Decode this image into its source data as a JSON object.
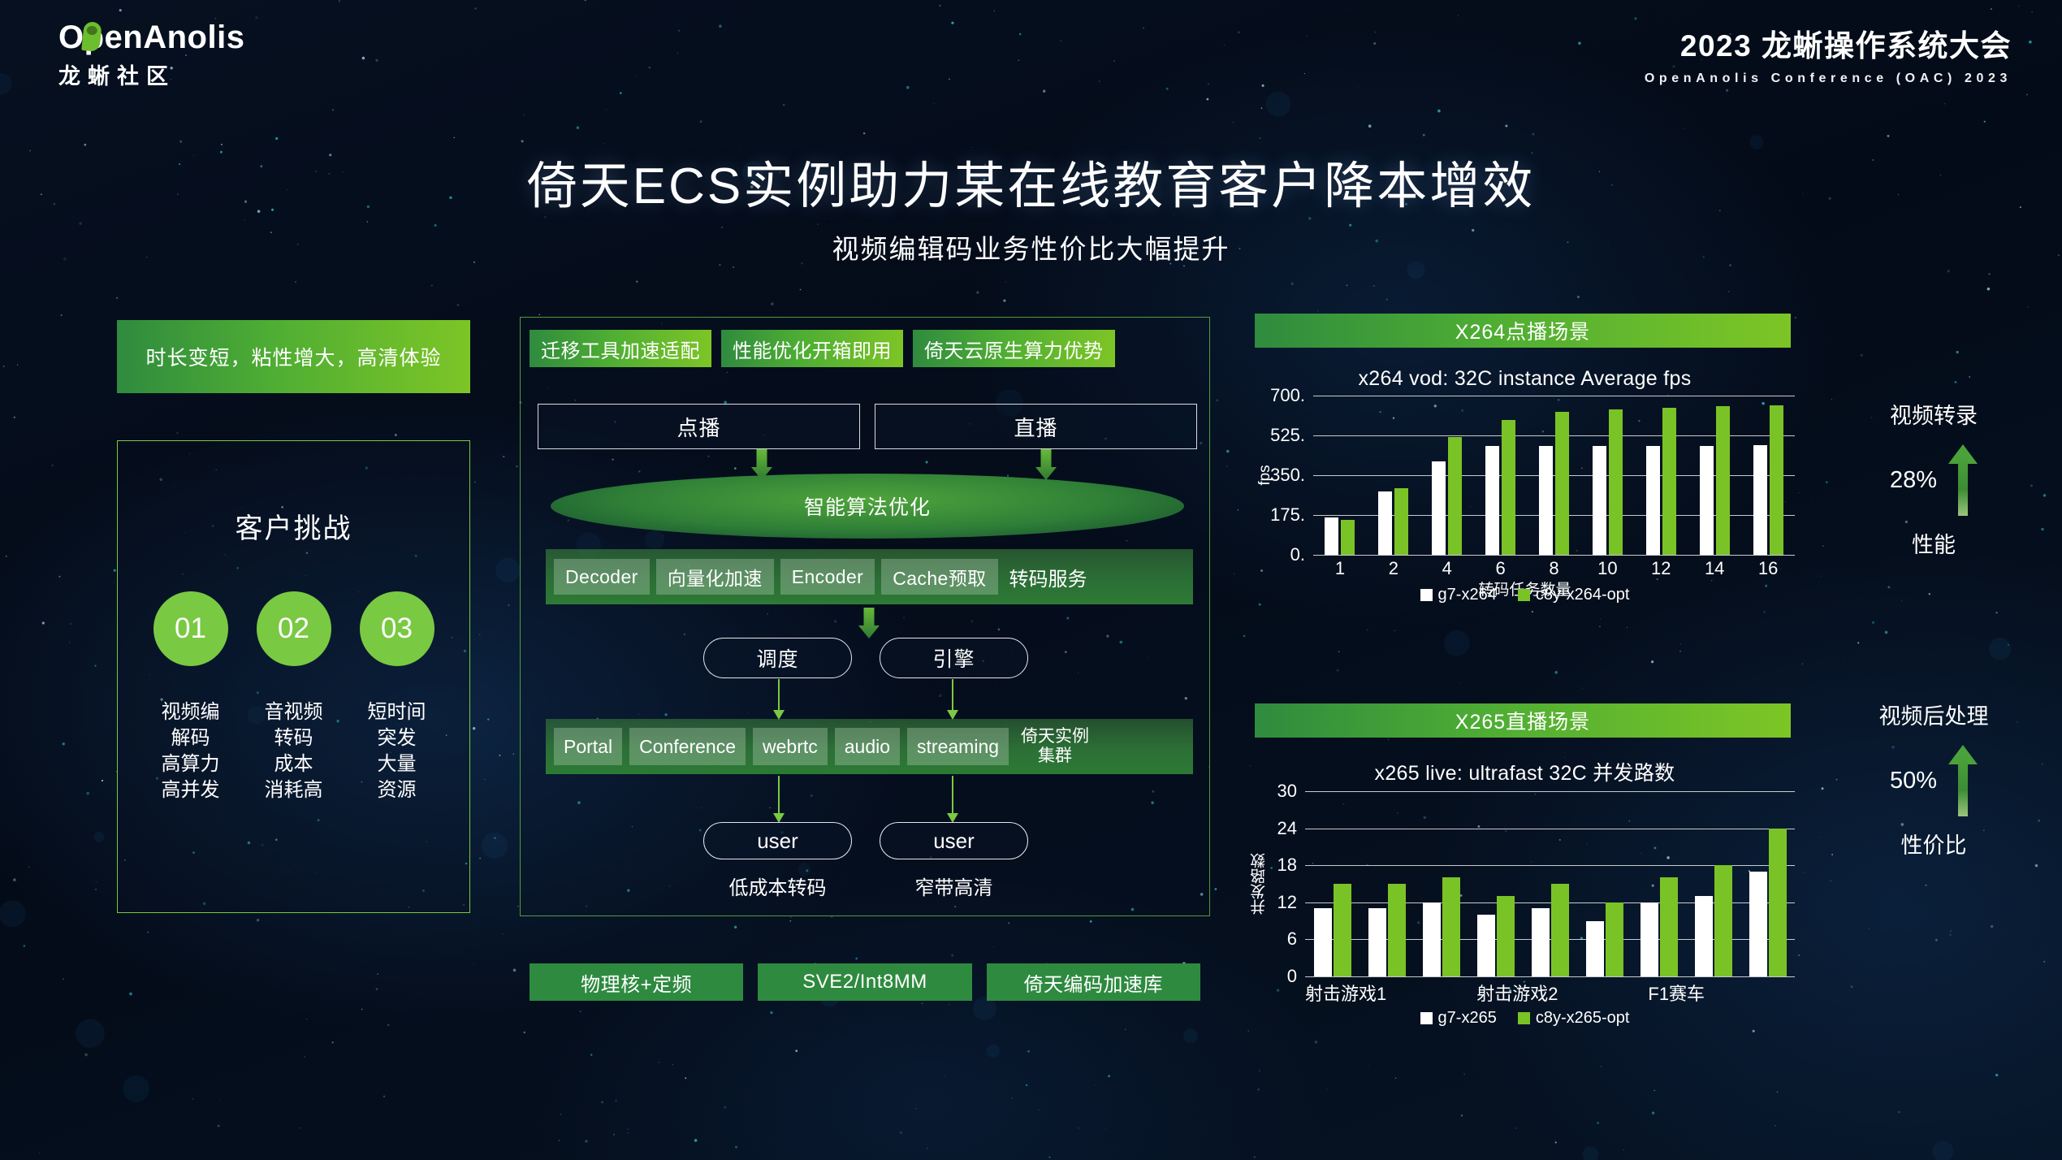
{
  "header": {
    "logo_text": "OpenAnolis",
    "logo_sub": "龙蜥社区",
    "conf_title": "2023 龙蜥操作系统大会",
    "conf_sub": "OpenAnolis Conference (OAC) 2023"
  },
  "title": {
    "main": "倚天ECS实例助力某在线教育客户降本增效",
    "sub": "视频编辑码业务性价比大幅提升"
  },
  "left": {
    "banner": "时长变短，粘性增大，高清体验",
    "box_title": "客户挑战",
    "items": [
      {
        "num": "01",
        "text": "视频编\n解码\n高算力\n高并发"
      },
      {
        "num": "02",
        "text": "音视频\n转码\n成本\n消耗高"
      },
      {
        "num": "03",
        "text": "短时间\n突发\n大量\n资源"
      }
    ]
  },
  "middle": {
    "tags": [
      "迁移工具加速适配",
      "性能优化开箱即用",
      "倚天云原生算力优势"
    ],
    "lanes": [
      "点播",
      "直播"
    ],
    "ellipse": "智能算法优化",
    "service_chips": [
      "Decoder",
      "向量化加速",
      "Encoder",
      "Cache预取"
    ],
    "service_label": "转码服务",
    "round_nodes": [
      "调度",
      "引擎"
    ],
    "cluster_chips": [
      "Portal",
      "Conference",
      "webrtc",
      "audio",
      "streaming"
    ],
    "cluster_label": "倚天实例\n集群",
    "users": [
      "user",
      "user"
    ],
    "user_captions": [
      "低成本转码",
      "窄带高清"
    ],
    "bottom_tags": [
      "物理核+定频",
      "SVE2/Int8MM",
      "倚天编码加速库"
    ]
  },
  "annotations": [
    {
      "top": "视频转录",
      "pct": "28%",
      "bottom": "性能"
    },
    {
      "top": "视频后处理",
      "pct": "50%",
      "bottom": "性价比"
    }
  ],
  "colors": {
    "green": "#7ac326",
    "green_dark": "#2e8a3f",
    "white": "#ffffff",
    "bg": "#050d1c"
  },
  "chart_data": [
    {
      "type": "bar",
      "header": "X264点播场景",
      "title": "x264 vod: 32C instance Average fps",
      "xlabel": "转码任务数量",
      "ylabel": "fps",
      "categories": [
        "1",
        "2",
        "4",
        "6",
        "8",
        "10",
        "12",
        "14",
        "16"
      ],
      "ylim": [
        0,
        700
      ],
      "yticks": [
        0,
        175,
        350,
        525,
        700
      ],
      "ytick_labels": [
        "0.",
        "175.",
        "350.",
        "525.",
        "700."
      ],
      "grid": true,
      "legend_position": "bottom",
      "series": [
        {
          "name": "g7-x264",
          "color": "#ffffff",
          "values": [
            163,
            277,
            412,
            478,
            480,
            480,
            480,
            480,
            482
          ]
        },
        {
          "name": "c8y-x264-opt",
          "color": "#7ac326",
          "values": [
            152,
            292,
            518,
            593,
            627,
            641,
            648,
            653,
            657
          ]
        }
      ]
    },
    {
      "type": "bar",
      "header": "X265直播场景",
      "title": "x265 live: ultrafast 32C 并发路数",
      "xlabel": "",
      "ylabel": "并发路数",
      "categories": [
        "射击游戏1",
        "",
        "射击游戏2",
        "",
        "F1赛车",
        "",
        "",
        ""
      ],
      "xtick_labels": [
        "射击游戏1",
        "射击游戏2",
        "F1赛车"
      ],
      "ylim": [
        0,
        30
      ],
      "yticks": [
        0,
        6,
        12,
        18,
        24,
        30
      ],
      "ytick_labels": [
        "0",
        "6",
        "12",
        "18",
        "24",
        "30"
      ],
      "grid": true,
      "legend_position": "bottom",
      "series": [
        {
          "name": "g7-x265",
          "color": "#ffffff",
          "values": [
            11,
            11,
            12,
            10,
            11,
            9,
            12,
            13,
            17
          ]
        },
        {
          "name": "c8y-x265-opt",
          "color": "#7ac326",
          "values": [
            15,
            15,
            16,
            13,
            15,
            12,
            16,
            18,
            24
          ]
        }
      ]
    }
  ]
}
